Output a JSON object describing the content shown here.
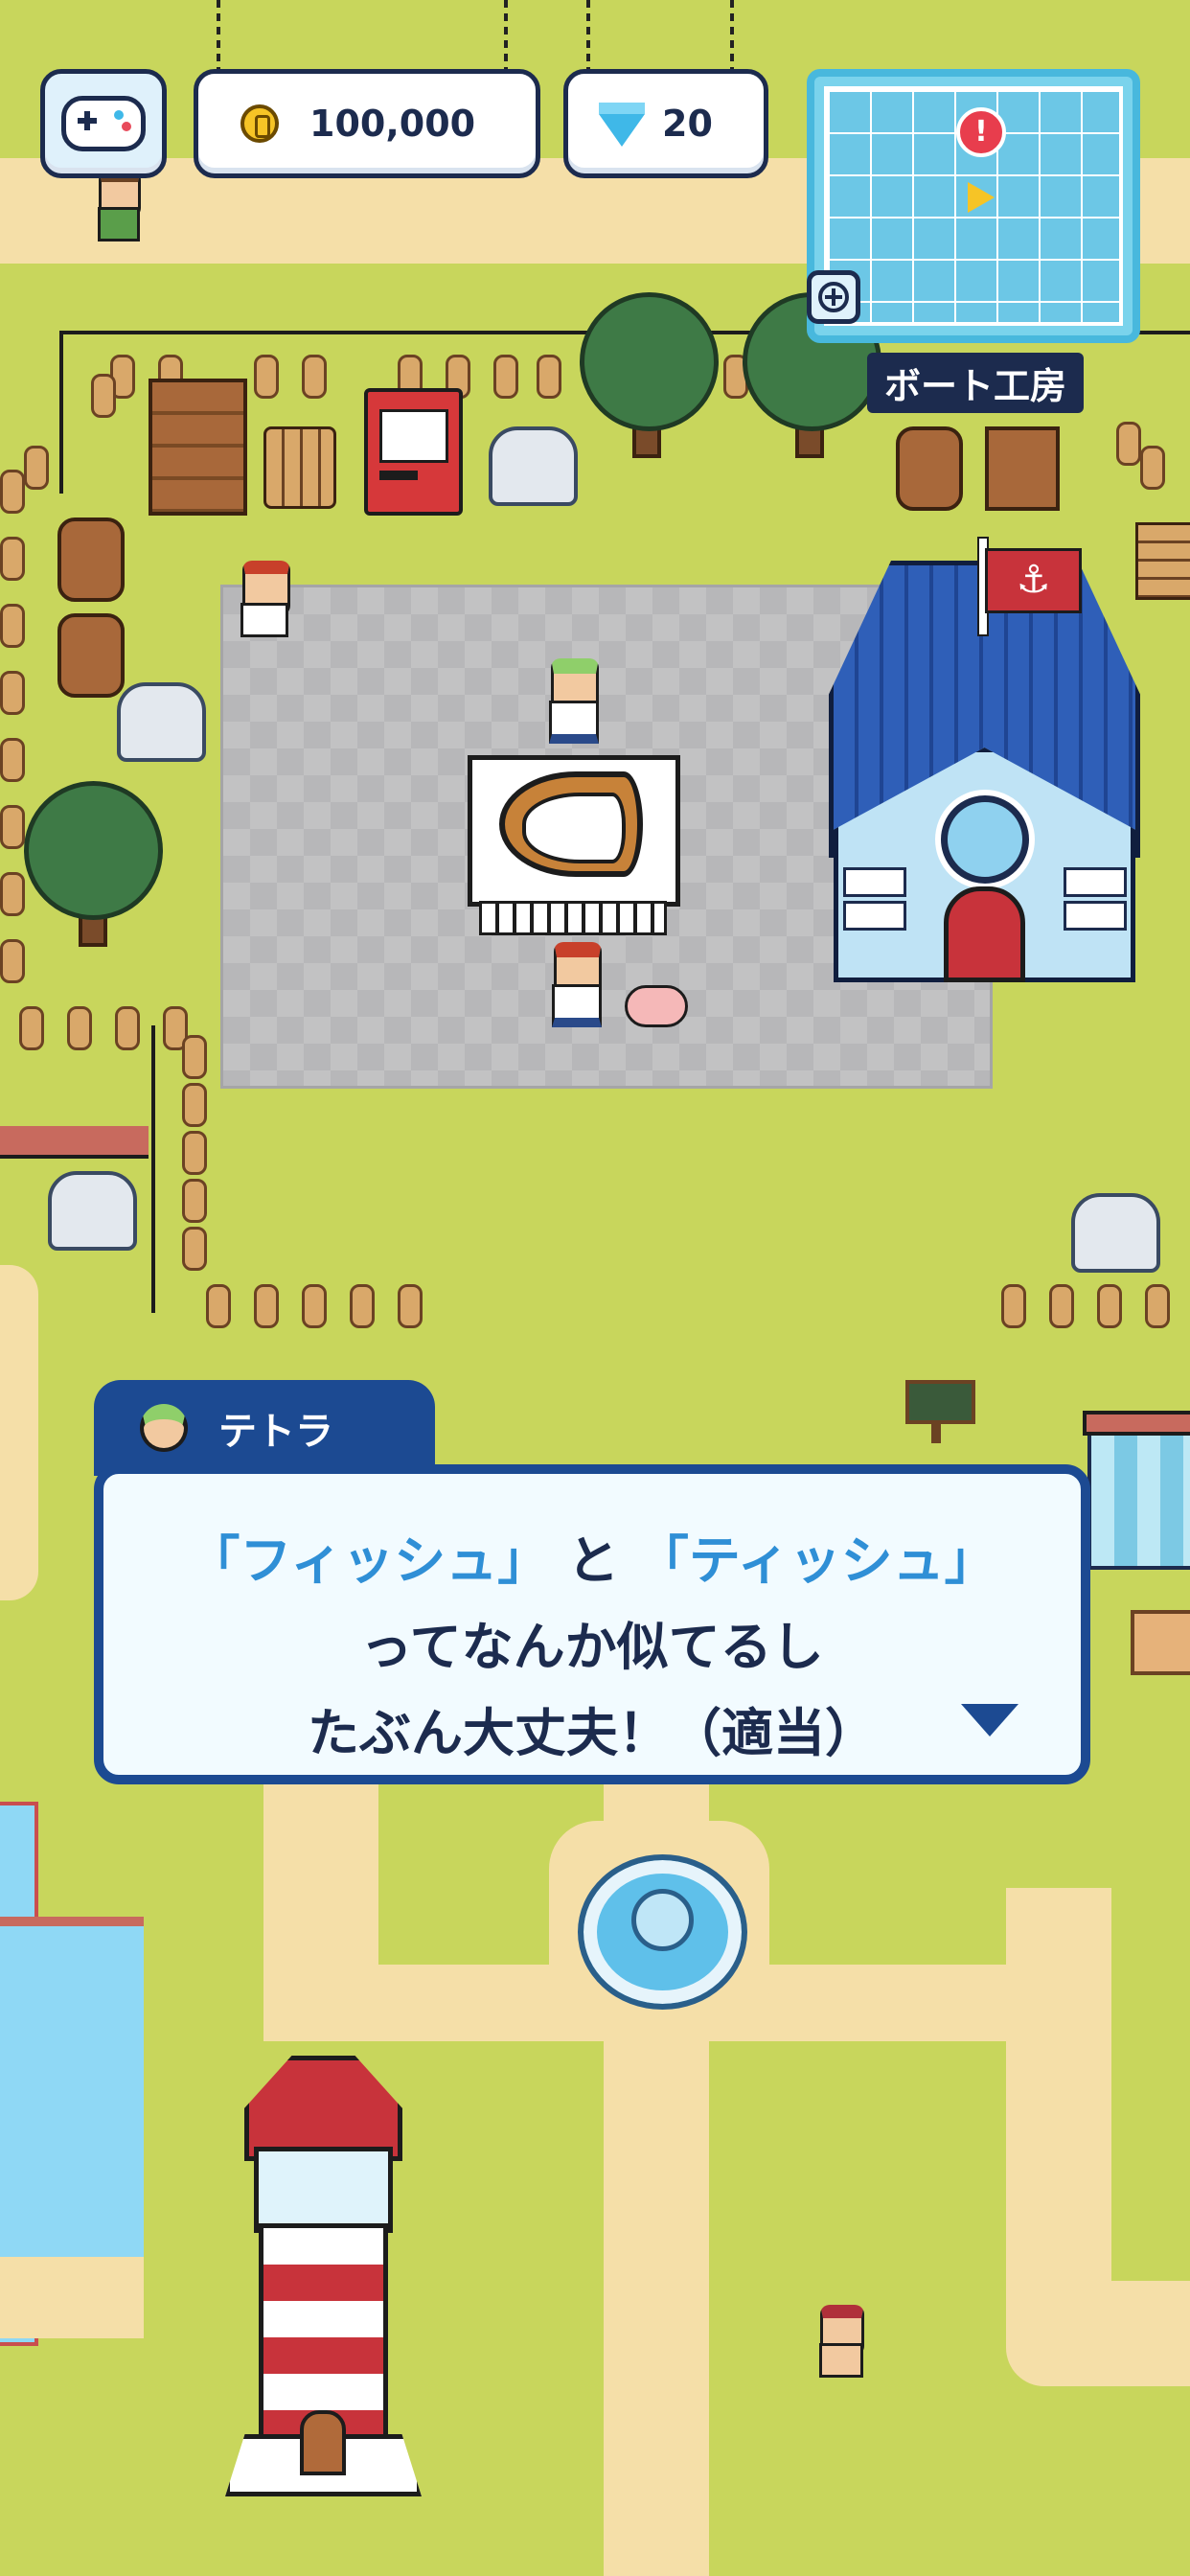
{
  "hud": {
    "controller_icon": "gamepad-icon",
    "coins": "100,000",
    "coin_icon": "coin-icon",
    "gems": "20",
    "gem_icon": "diamond-icon"
  },
  "minimap": {
    "location_label": "ボート工房",
    "zoom_icon": "plus-circle-icon",
    "alert_icon": "exclamation-icon",
    "player_icon": "arrow-marker-icon"
  },
  "dialog": {
    "speaker_name": "テトラ",
    "speaker_avatar": "tetra-avatar-icon",
    "line1_part1": "「フィッシュ」",
    "line1_part2": "と",
    "line1_part3": "「ティッシュ」",
    "line2": "ってなんか似てるし",
    "line3": "たぶん大丈夫！（適当）",
    "next_icon": "chevron-down-icon"
  },
  "colors": {
    "grass": "#c8d65c",
    "path": "#f5dfa8",
    "ui_navy": "#1c2b4e",
    "dialog_blue": "#1c4a92",
    "highlight": "#2f8fd6",
    "water": "#8fd8f5"
  }
}
